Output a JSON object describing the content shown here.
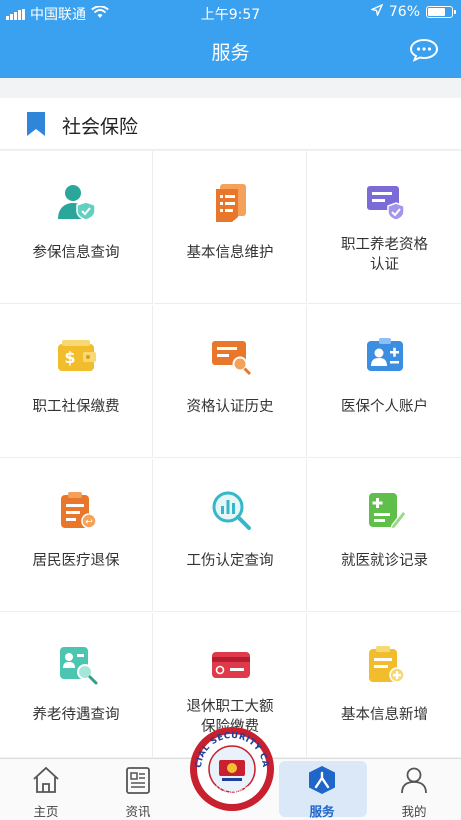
{
  "status": {
    "carrier": "中国联通",
    "time": "上午9:57",
    "battery": "76%",
    "battery_level": 0.76
  },
  "header": {
    "title": "服务",
    "message_icon": "chat-bubble-icon"
  },
  "section": {
    "title": "社会保险",
    "icon": "bookmark-icon"
  },
  "services": [
    {
      "label": "参保信息查询",
      "icon": "user-shield-icon"
    },
    {
      "label": "基本信息维护",
      "icon": "document-list-icon"
    },
    {
      "label": "职工养老资格\n认证",
      "icon": "card-check-icon"
    },
    {
      "label": "职工社保缴费",
      "icon": "wallet-yuan-icon"
    },
    {
      "label": "资格认证历史",
      "icon": "card-search-icon"
    },
    {
      "label": "医保个人账户",
      "icon": "medical-id-icon"
    },
    {
      "label": "居民医疗退保",
      "icon": "clipboard-return-icon"
    },
    {
      "label": "工伤认定查询",
      "icon": "chart-search-icon"
    },
    {
      "label": "就医就诊记录",
      "icon": "medical-record-icon"
    },
    {
      "label": "养老待遇查询",
      "icon": "pension-search-icon"
    },
    {
      "label": "退休职工大额\n保险缴费",
      "icon": "bank-card-icon"
    },
    {
      "label": "基本信息新增",
      "icon": "clipboard-add-icon"
    }
  ],
  "card_text": {
    "top": "SOCIAL SECURITY CARD",
    "bottom": "社会保障卡"
  },
  "tabs": [
    {
      "label": "主页",
      "icon": "home-icon"
    },
    {
      "label": "资讯",
      "icon": "news-icon"
    },
    {
      "label": "",
      "icon": "social-security-card-icon"
    },
    {
      "label": "服务",
      "icon": "service-person-icon",
      "active": true
    },
    {
      "label": "我的",
      "icon": "profile-icon"
    }
  ],
  "colors": {
    "header_bg": "#3aa0f0",
    "active_tab_bg": "#dbe8f8",
    "active_tab_text": "#1e66c8",
    "section_bookmark": "#2f86d8"
  }
}
